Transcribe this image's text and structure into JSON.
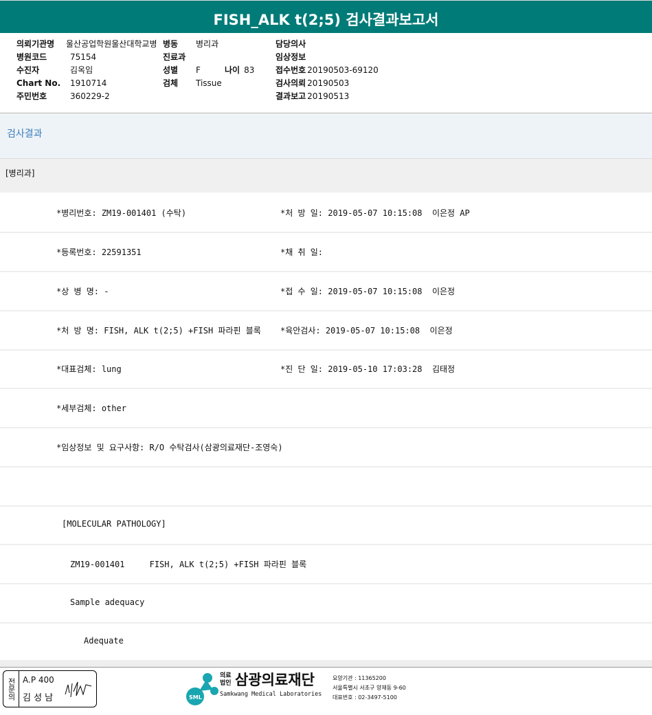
{
  "title": "FISH_ALK t(2;5) 검사결과보고서",
  "header": {
    "institution_label": "의뢰기관명",
    "institution": "울산공업학원울산대학교병",
    "ward_label": "병동",
    "ward": "병리과",
    "doctor_label": "담당의사",
    "hospital_code_label": "병원코드",
    "hospital_code": "75154",
    "dept_label": "진료과",
    "clinical_label": "임상정보",
    "patient_label": "수진자",
    "patient": "김옥임",
    "sex_label": "성별",
    "sex": "F",
    "age_label": "나이",
    "age": "83",
    "receipt_label": "접수번호",
    "receipt": "20190503-69120",
    "chart_label": "Chart No.",
    "chart": "1910714",
    "specimen_label": "검체",
    "specimen": "Tissue",
    "request_label": "검사의뢰",
    "request": "20190503",
    "rrn_label": "주민번호",
    "rrn": "360229-2",
    "report_label": "결과보고",
    "report": "20190513"
  },
  "section": "검사결과",
  "dept_tag": "[병리과]",
  "rows": [
    {
      "left": "*병리번호: ZM19-001401 (수탁)",
      "right": "*처 방 일: 2019-05-07 10:15:08  이은정 AP"
    },
    {
      "left": "*등록번호: 22591351",
      "right": "*채 취 일:"
    },
    {
      "left": "*상 병 명: -",
      "right": "*접 수 일: 2019-05-07 10:15:08  이은정"
    },
    {
      "left": "*처 방 명: FISH, ALK t(2;5) +FISH 파라핀 블록",
      "right": "*육안검사: 2019-05-07 10:15:08  이은정"
    },
    {
      "left": "*대표검체: lung",
      "right": "*진 단 일: 2019-05-10 17:03:28  김태정"
    },
    {
      "left": "*세부검체: other",
      "right": ""
    },
    {
      "left": "*임상정보 및 요구사항: R/O 수탁검사(삼광의료재단-조영숙)",
      "right": ""
    },
    {
      "left": "",
      "right": ""
    }
  ],
  "result_lines": [
    "[MOLECULAR PATHOLOGY]",
    "ZM19-001401     FISH, ALK t(2;5) +FISH 파라핀 블록",
    "Sample adequacy",
    "Adequate"
  ],
  "footer": {
    "stamp_side": "전문의",
    "stamp_code": "A.P 400",
    "stamp_name": "김 성 남",
    "logo_prefix1": "의료",
    "logo_prefix2": "법인",
    "logo_name": "삼광의료재단",
    "logo_en": "Samkwang Medical Laboratories",
    "logo_mark": "SML",
    "code": "요양기관 : 11365200",
    "address": "서울특별시 서초구 양재동 9-60",
    "phone": "대표번호 : 02-3497-5100"
  },
  "colors": {
    "header": "#007b78",
    "section_text": "#3d7fbf",
    "logo": "#1aa6b0"
  }
}
